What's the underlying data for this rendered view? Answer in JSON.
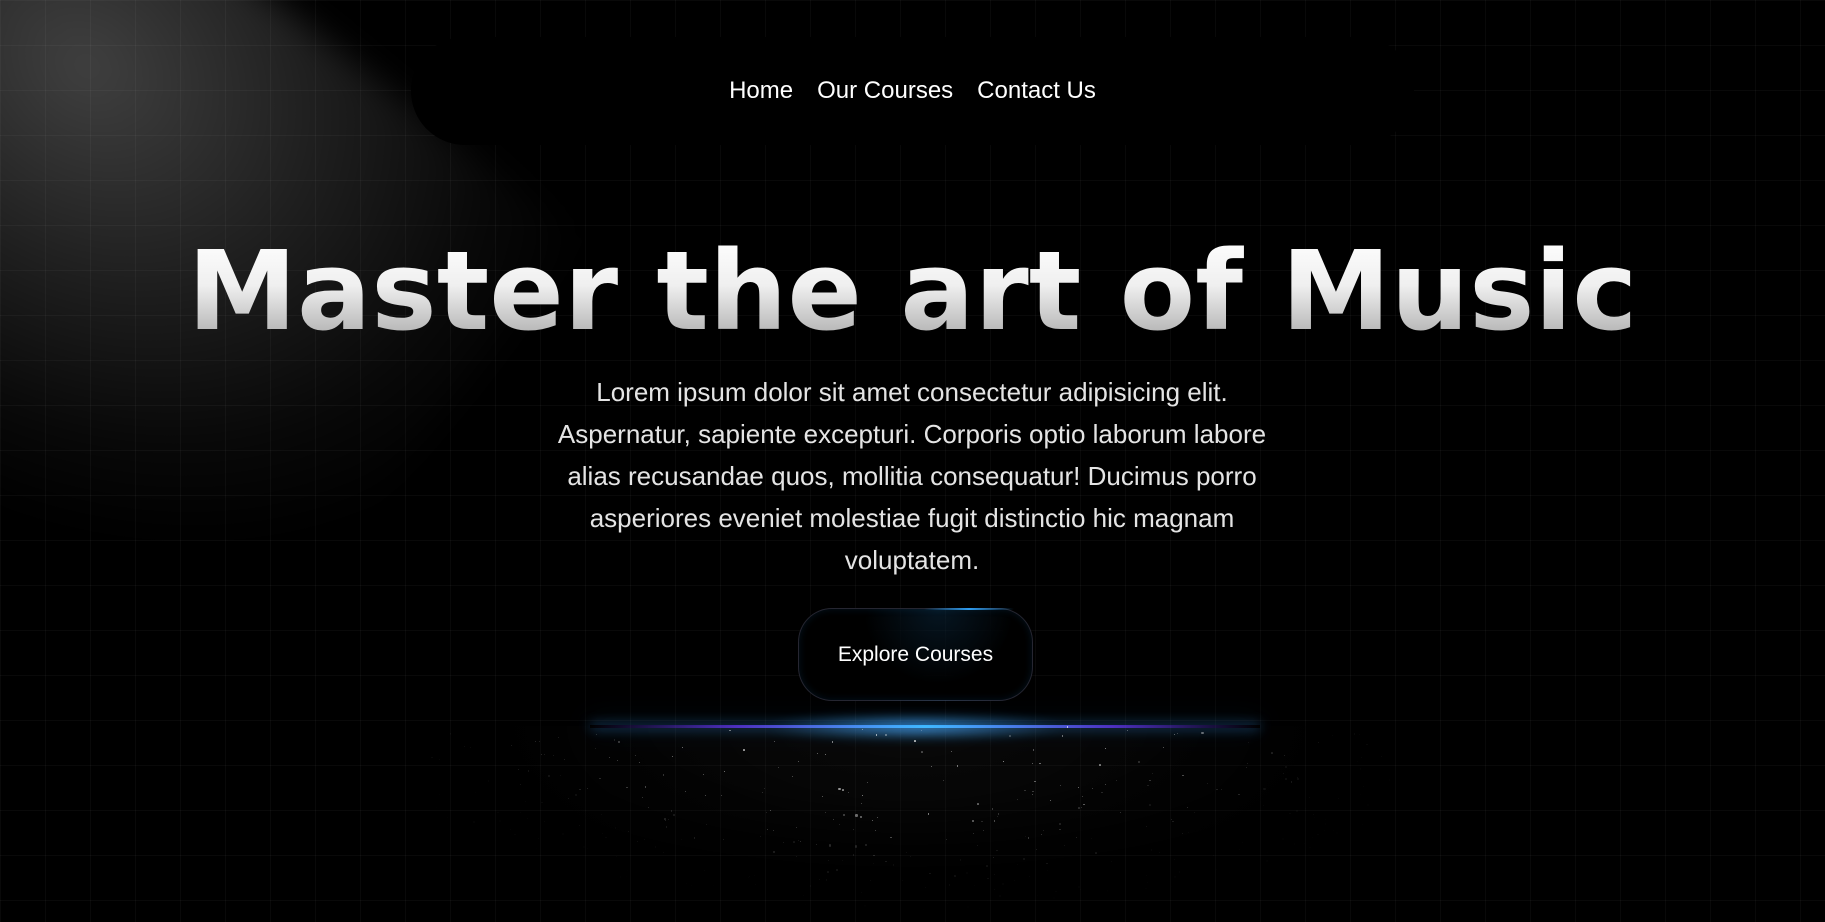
{
  "nav": {
    "items": [
      {
        "label": "Home"
      },
      {
        "label": "Our Courses"
      },
      {
        "label": "Contact Us"
      }
    ]
  },
  "hero": {
    "title": "Master the art of Music",
    "description": "Lorem ipsum dolor sit amet consectetur adipisicing elit. Aspernatur, sapiente excepturi. Corporis optio laborum labore alias recusandae quos, mollitia consequatur! Ducimus porro asperiores eveniet molestiae fugit distinctio hic magnam voluptatem.",
    "cta_label": "Explore Courses"
  },
  "colors": {
    "background": "#000000",
    "text": "#ffffff",
    "accent": "#3bb7ff",
    "violet": "#643cff"
  }
}
